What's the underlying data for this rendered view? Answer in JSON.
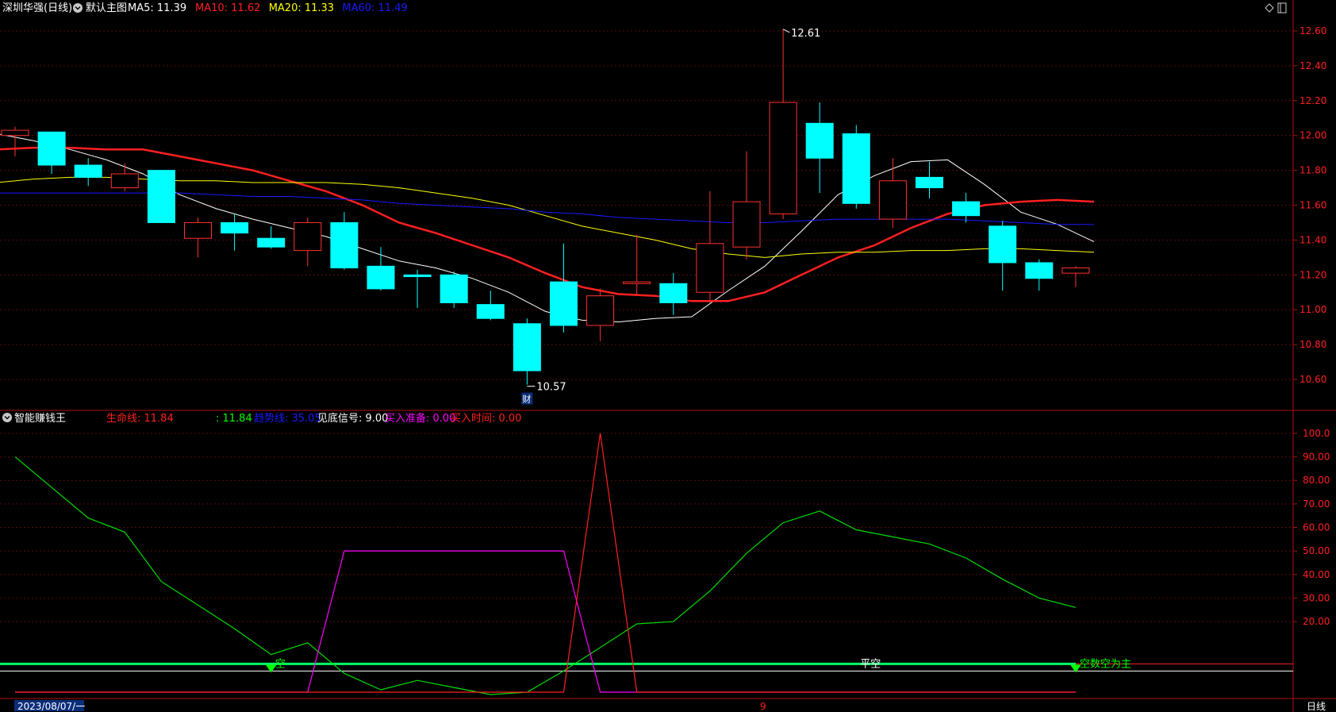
{
  "header": {
    "stock_name": "深圳华强(日线)",
    "template_label": "默认主图",
    "ma_labels": [
      {
        "text": "MA5: 11.39",
        "color": "#ffffff"
      },
      {
        "text": "MA10: 11.62",
        "color": "#ff2020"
      },
      {
        "text": "MA20: 11.33",
        "color": "#ffff00"
      },
      {
        "text": "MA60: 11.49",
        "color": "#1a1aff"
      }
    ]
  },
  "indicator_header": {
    "name": "智能赚钱王",
    "items": [
      {
        "text": "生命线: 11.84",
        "color": "#ff2020"
      },
      {
        "text": ": 11.84",
        "color": "#00ff00"
      },
      {
        "text": "趋势线: 35.05",
        "color": "#1a1aff"
      },
      {
        "text": "见底信号: 9.00",
        "color": "#ffffff"
      },
      {
        "text": "买入准备: 0.00",
        "color": "#ff00ff"
      },
      {
        "text": "买入时间: 0.00",
        "color": "#ff2020"
      }
    ]
  },
  "footer": {
    "date_label": "2023/08/07/一",
    "month_marker": "9",
    "period_label": "日线"
  },
  "chart_data": [
    {
      "type": "candlestick",
      "title": "深圳华强(日线)",
      "ylim": [
        10.5,
        12.65
      ],
      "y_ticks": [
        10.6,
        10.8,
        11.0,
        11.2,
        11.4,
        11.6,
        11.8,
        12.0,
        12.2,
        12.4,
        12.6
      ],
      "candles": [
        {
          "o": 12.0,
          "h": 12.05,
          "l": 11.88,
          "c": 12.03
        },
        {
          "o": 12.02,
          "h": 12.02,
          "l": 11.78,
          "c": 11.83
        },
        {
          "o": 11.83,
          "h": 11.87,
          "l": 11.71,
          "c": 11.76
        },
        {
          "o": 11.7,
          "h": 11.84,
          "l": 11.68,
          "c": 11.78
        },
        {
          "o": 11.8,
          "h": 11.8,
          "l": 11.5,
          "c": 11.5
        },
        {
          "o": 11.41,
          "h": 11.53,
          "l": 11.3,
          "c": 11.5
        },
        {
          "o": 11.5,
          "h": 11.55,
          "l": 11.34,
          "c": 11.44
        },
        {
          "o": 11.41,
          "h": 11.48,
          "l": 11.35,
          "c": 11.36
        },
        {
          "o": 11.34,
          "h": 11.53,
          "l": 11.25,
          "c": 11.5
        },
        {
          "o": 11.5,
          "h": 11.56,
          "l": 11.23,
          "c": 11.24
        },
        {
          "o": 11.25,
          "h": 11.36,
          "l": 11.11,
          "c": 11.12
        },
        {
          "o": 11.2,
          "h": 11.23,
          "l": 11.01,
          "c": 11.19
        },
        {
          "o": 11.2,
          "h": 11.22,
          "l": 11.01,
          "c": 11.04
        },
        {
          "o": 11.03,
          "h": 11.11,
          "l": 10.94,
          "c": 10.95
        },
        {
          "o": 10.92,
          "h": 10.95,
          "l": 10.57,
          "c": 10.65
        },
        {
          "o": 11.16,
          "h": 11.38,
          "l": 10.87,
          "c": 10.91
        },
        {
          "o": 10.91,
          "h": 11.12,
          "l": 10.82,
          "c": 11.08
        },
        {
          "o": 11.15,
          "h": 11.43,
          "l": 11.09,
          "c": 11.16
        },
        {
          "o": 11.15,
          "h": 11.21,
          "l": 10.97,
          "c": 11.04
        },
        {
          "o": 11.1,
          "h": 11.68,
          "l": 11.04,
          "c": 11.38
        },
        {
          "o": 11.36,
          "h": 11.91,
          "l": 11.29,
          "c": 11.62
        },
        {
          "o": 11.55,
          "h": 12.61,
          "l": 11.52,
          "c": 12.19
        },
        {
          "o": 12.07,
          "h": 12.19,
          "l": 11.67,
          "c": 11.87
        },
        {
          "o": 12.01,
          "h": 12.06,
          "l": 11.58,
          "c": 11.61
        },
        {
          "o": 11.52,
          "h": 11.87,
          "l": 11.47,
          "c": 11.74
        },
        {
          "o": 11.76,
          "h": 11.85,
          "l": 11.64,
          "c": 11.7
        },
        {
          "o": 11.62,
          "h": 11.67,
          "l": 11.5,
          "c": 11.54
        },
        {
          "o": 11.48,
          "h": 11.51,
          "l": 11.11,
          "c": 11.27
        },
        {
          "o": 11.27,
          "h": 11.29,
          "l": 11.11,
          "c": 11.18
        },
        {
          "o": 11.21,
          "h": 11.25,
          "l": 11.13,
          "c": 11.24
        }
      ],
      "series": [
        {
          "name": "MA5",
          "color": "#ffffff",
          "width": 1,
          "values": [
            12.01,
            11.97,
            11.92,
            11.86,
            11.78,
            11.66,
            11.58,
            11.52,
            11.47,
            11.42,
            11.35,
            11.28,
            11.24,
            11.18,
            11.1,
            10.99,
            10.94,
            10.93,
            10.95,
            10.96,
            11.11,
            11.25,
            11.45,
            11.66,
            11.77,
            11.85,
            11.86,
            11.72,
            11.56,
            11.49,
            11.39
          ]
        },
        {
          "name": "MA10",
          "color": "#ff2020",
          "width": 2.5,
          "values": [
            11.92,
            11.93,
            11.93,
            11.92,
            11.92,
            11.88,
            11.84,
            11.8,
            11.74,
            11.68,
            11.6,
            11.5,
            11.44,
            11.37,
            11.3,
            11.21,
            11.13,
            11.09,
            11.08,
            11.05,
            11.05,
            11.1,
            11.2,
            11.3,
            11.37,
            11.47,
            11.55,
            11.6,
            11.62,
            11.63,
            11.62
          ]
        },
        {
          "name": "MA20",
          "color": "#ffff00",
          "width": 1,
          "values": [
            11.73,
            11.75,
            11.76,
            11.76,
            11.75,
            11.74,
            11.74,
            11.73,
            11.73,
            11.73,
            11.72,
            11.7,
            11.67,
            11.64,
            11.6,
            11.54,
            11.48,
            11.44,
            11.4,
            11.35,
            11.32,
            11.3,
            11.32,
            11.33,
            11.33,
            11.34,
            11.34,
            11.35,
            11.35,
            11.34,
            11.33
          ]
        },
        {
          "name": "MA60",
          "color": "#1a1aff",
          "width": 1,
          "values": [
            11.67,
            11.67,
            11.67,
            11.67,
            11.67,
            11.67,
            11.66,
            11.65,
            11.65,
            11.64,
            11.63,
            11.61,
            11.6,
            11.59,
            11.58,
            11.56,
            11.55,
            11.53,
            11.52,
            11.51,
            11.5,
            11.5,
            11.51,
            11.52,
            11.52,
            11.52,
            11.52,
            11.51,
            11.5,
            11.49,
            11.49
          ]
        }
      ],
      "annotations": {
        "high_label": "12.61",
        "low_label": "10.57",
        "event_label": "财"
      }
    },
    {
      "type": "line",
      "title": "智能赚钱王",
      "ylim": [
        -10,
        102
      ],
      "y_ticks": [
        20.0,
        30.0,
        40.0,
        50.0,
        60.0,
        70.0,
        80.0,
        90.0,
        100.0
      ],
      "series": [
        {
          "name": "趋势线",
          "color": "#00dd00",
          "values": [
            90,
            77,
            64,
            58,
            37,
            27,
            17,
            6,
            11,
            -2,
            -9,
            -5,
            -8,
            -11,
            -10,
            -1,
            9,
            19,
            20,
            33,
            49,
            62,
            67,
            59,
            56,
            53,
            47,
            38,
            30,
            26
          ]
        },
        {
          "name": "买入准备",
          "color": "#ff00ff",
          "values": [
            -10,
            -10,
            -10,
            -10,
            -10,
            -10,
            -10,
            -10,
            -10,
            50,
            50,
            50,
            50,
            50,
            50,
            50,
            -10,
            -10,
            -10,
            -10,
            -10,
            -10,
            -10,
            -10,
            -10,
            -10,
            -10,
            -10,
            -10,
            -10
          ]
        },
        {
          "name": "买入时间",
          "color": "#ff2020",
          "values": [
            -10,
            -10,
            -10,
            -10,
            -10,
            -10,
            -10,
            -10,
            -10,
            -10,
            -10,
            -10,
            -10,
            -10,
            -10,
            -10,
            100,
            -10,
            -10,
            -10,
            -10,
            -10,
            -10,
            -10,
            -10,
            -10,
            -10,
            -10,
            -10,
            -10
          ]
        }
      ],
      "level_lines": [
        {
          "value": 2,
          "color": "#ff2020"
        },
        {
          "value": -1,
          "color": "#ffffff"
        }
      ],
      "markers": [
        {
          "index": 7,
          "text": "空"
        },
        {
          "index": 23,
          "text": "平空"
        },
        {
          "index": 29,
          "text": "空数空为主"
        }
      ]
    }
  ]
}
